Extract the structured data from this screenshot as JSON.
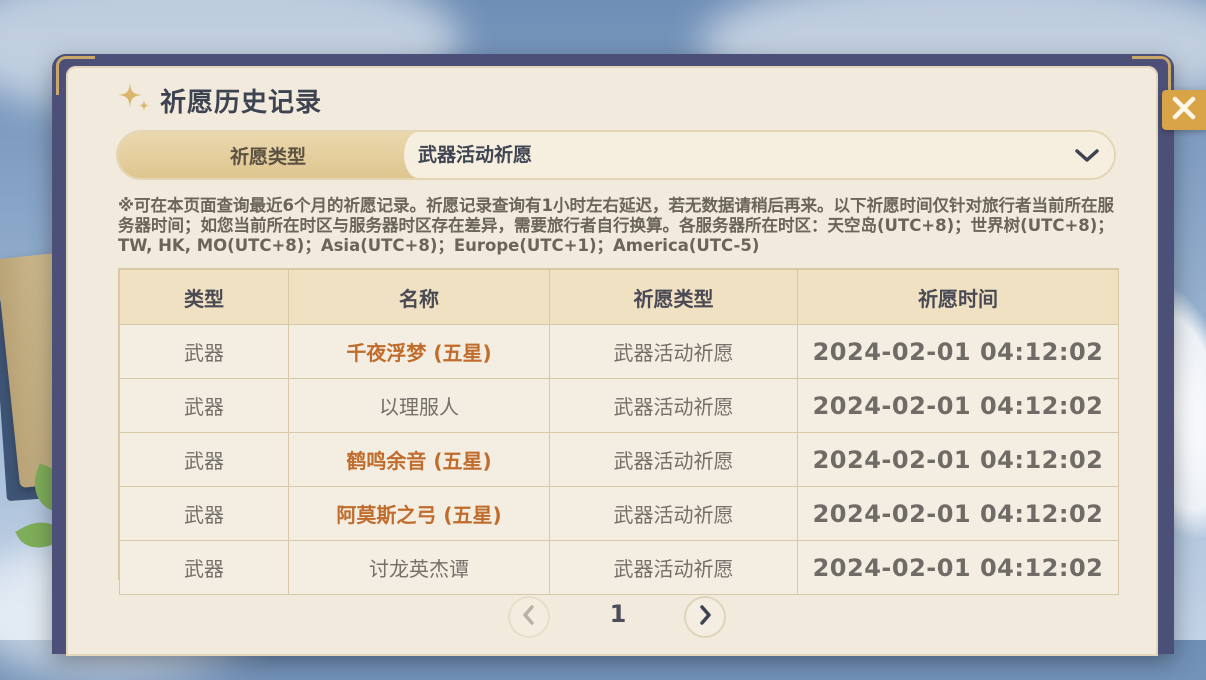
{
  "header": {
    "title": "祈愿历史记录"
  },
  "selector": {
    "label": "祈愿类型",
    "value": "武器活动祈愿"
  },
  "notice": "※可在本页面查询最近6个月的祈愿记录。祈愿记录查询有1小时左右延迟，若无数据请稍后再来。以下祈愿时间仅针对旅行者当前所在服务器时间；如您当前所在时区与服务器时区存在差异，需要旅行者自行换算。各服务器所在时区：天空岛(UTC+8)；世界树(UTC+8)；TW, HK, MO(UTC+8)；Asia(UTC+8)；Europe(UTC+1)；America(UTC-5)",
  "table": {
    "headers": [
      "类型",
      "名称",
      "祈愿类型",
      "祈愿时间"
    ],
    "rows": [
      {
        "type": "武器",
        "name": "千夜浮梦 (五星)",
        "wish_type": "武器活动祈愿",
        "time": "2024-02-01 04:12:02"
      },
      {
        "type": "武器",
        "name": "以理服人",
        "wish_type": "武器活动祈愿",
        "time": "2024-02-01 04:12:02"
      },
      {
        "type": "武器",
        "name": "鹤鸣余音 (五星)",
        "wish_type": "武器活动祈愿",
        "time": "2024-02-01 04:12:02"
      },
      {
        "type": "武器",
        "name": "阿莫斯之弓 (五星)",
        "wish_type": "武器活动祈愿",
        "time": "2024-02-01 04:12:02"
      },
      {
        "type": "武器",
        "name": "讨龙英杰谭",
        "wish_type": "武器活动祈愿",
        "time": "2024-02-01 04:12:02"
      }
    ]
  },
  "pagination": {
    "page": "1"
  },
  "colors": {
    "five_star": "#bf6c2c",
    "panel": "#f2ebdd",
    "header_bg": "#efe1c2",
    "close_button": "#d9a347"
  },
  "icons": {
    "title": "sparkle-icon",
    "close": "close-icon",
    "dropdown": "chevron-down-icon",
    "prev": "chevron-left-icon",
    "next": "chevron-right-icon"
  }
}
